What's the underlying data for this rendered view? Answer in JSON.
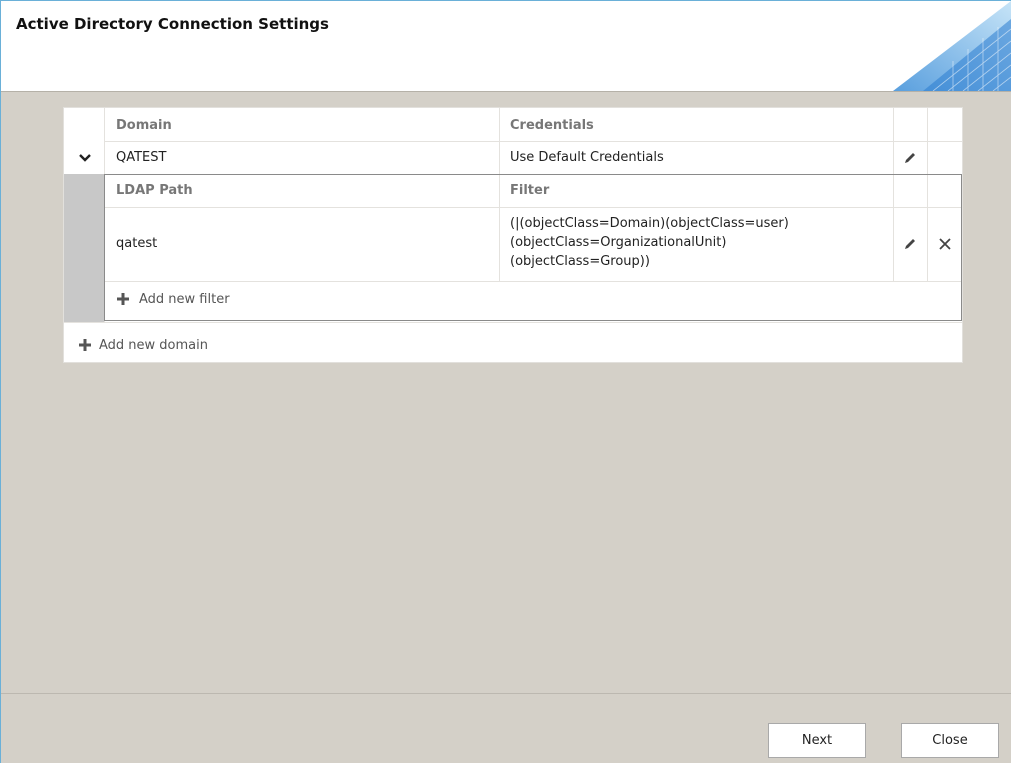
{
  "window": {
    "title": "Active Directory Connection Settings"
  },
  "domains_table": {
    "columns": {
      "domain": "Domain",
      "credentials": "Credentials"
    },
    "rows": [
      {
        "domain": "QATEST",
        "credentials": "Use Default Credentials",
        "expanded": true,
        "filters_table": {
          "columns": {
            "ldap_path": "LDAP Path",
            "filter": "Filter"
          },
          "rows": [
            {
              "ldap_path": "qatest",
              "filter_lines": [
                "(|(objectClass=Domain)(objectClass=user)",
                "(objectClass=OrganizationalUnit)",
                "(objectClass=Group))"
              ]
            }
          ],
          "add_label": "Add new filter"
        }
      }
    ],
    "add_label": "Add new domain"
  },
  "buttons": {
    "next": "Next",
    "close": "Close"
  },
  "icons": {
    "expand": "chevron-down-icon",
    "edit": "pencil-icon",
    "delete": "close-icon",
    "add": "plus-icon"
  },
  "colors": {
    "accent_border": "#6ab0d8",
    "dialog_background": "#d4d0c8",
    "expand_column": "#c8c8c8"
  }
}
